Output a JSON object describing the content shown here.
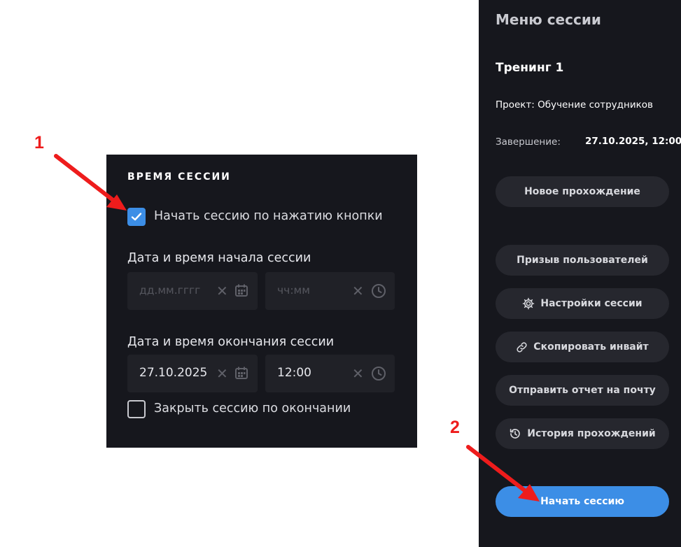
{
  "session_time": {
    "title": "ВРЕМЯ СЕССИИ",
    "start_on_button": {
      "label": "Начать сессию по нажатию кнопки",
      "checked": true
    },
    "start": {
      "label": "Дата и время начала сессии",
      "date_placeholder": "дд.мм.гггг",
      "time_placeholder": "чч:мм"
    },
    "end": {
      "label": "Дата и время окончания сессии",
      "date_value": "27.10.2025",
      "time_value": "12:00"
    },
    "close_on_end": {
      "label": "Закрыть сессию по окончании",
      "checked": false
    }
  },
  "sidebar": {
    "title": "Меню сессии",
    "training_name": "Тренинг 1",
    "project": "Проект: Обучение сотрудников",
    "end_label": "Завершение:",
    "end_value": "27.10.2025, 12:00",
    "buttons": {
      "new_attempt": "Новое прохождение",
      "invite_users": "Призыв пользователей",
      "session_settings": "Настройки сессии",
      "copy_invite": "Скопировать инвайт",
      "send_report": "Отправить отчет на почту",
      "history": "История прохождений",
      "start_session": "Начать сессию"
    }
  },
  "annotations": {
    "marker_1": "1",
    "marker_2": "2"
  },
  "colors": {
    "panel_bg": "#16171d",
    "field_bg": "#202127",
    "button_bg": "#26272e",
    "accent": "#3c8ee6",
    "annotation": "#ee1c1c"
  }
}
